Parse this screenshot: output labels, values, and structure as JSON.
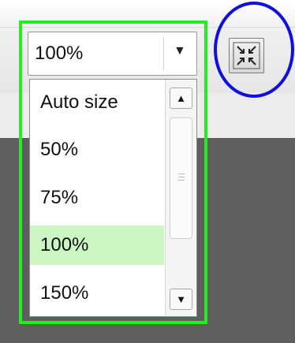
{
  "zoom_select": {
    "value": "100%",
    "arrow_icon": "chevron-down-icon"
  },
  "zoom_options": [
    {
      "label": "Auto size",
      "selected": false
    },
    {
      "label": "50%",
      "selected": false
    },
    {
      "label": "75%",
      "selected": false
    },
    {
      "label": "100%",
      "selected": true
    },
    {
      "label": "150%",
      "selected": false
    }
  ],
  "scrollbar": {
    "up_icon": "scroll-up-icon",
    "down_icon": "scroll-down-icon"
  },
  "fit_button": {
    "icon": "fit-to-window-icon"
  },
  "annotation_colors": {
    "highlight_box": "#22ee22",
    "circle": "#1010dd",
    "selected_item": "#ccf5c3"
  }
}
